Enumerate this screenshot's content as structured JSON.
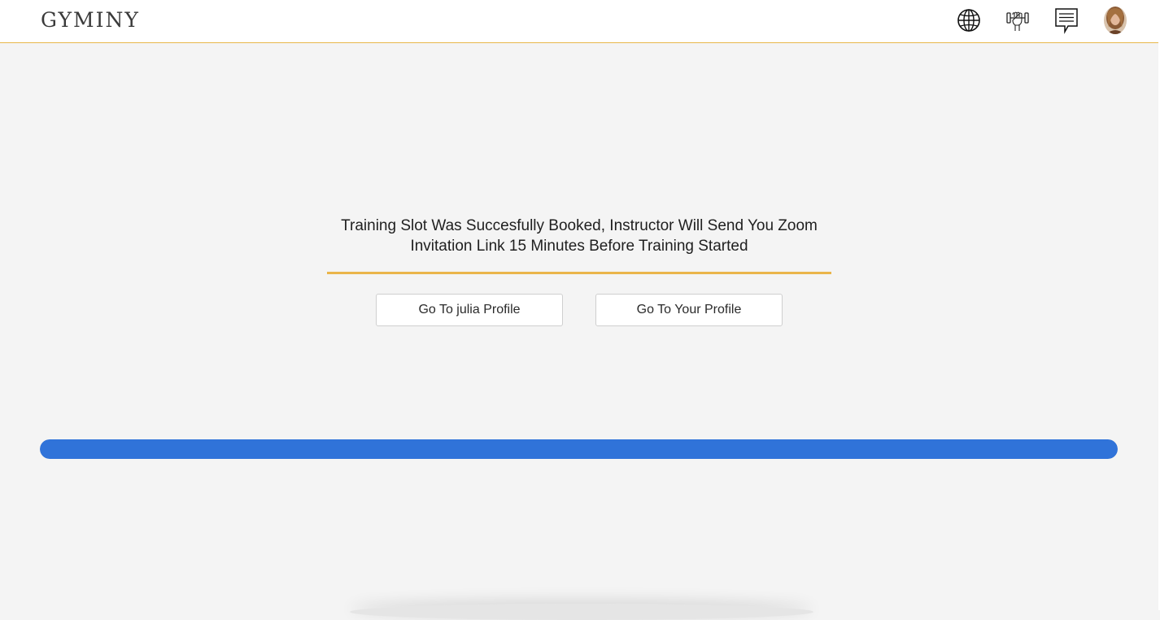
{
  "header": {
    "logo": "GYMINY",
    "accent_color": "#e8b84a",
    "icons": [
      "globe-icon",
      "dumbbell-hand-icon",
      "chat-icon",
      "avatar"
    ]
  },
  "main": {
    "message": "Training Slot Was Succesfully Booked, Instructor Will Send You Zoom Invitation Link 15 Minutes Before Training Started",
    "divider_color": "#eab54a",
    "buttons": {
      "julia_profile": "Go To julia Profile",
      "your_profile": "Go To Your Profile"
    }
  },
  "progress": {
    "value": 1.0,
    "color": "#3073d9"
  }
}
